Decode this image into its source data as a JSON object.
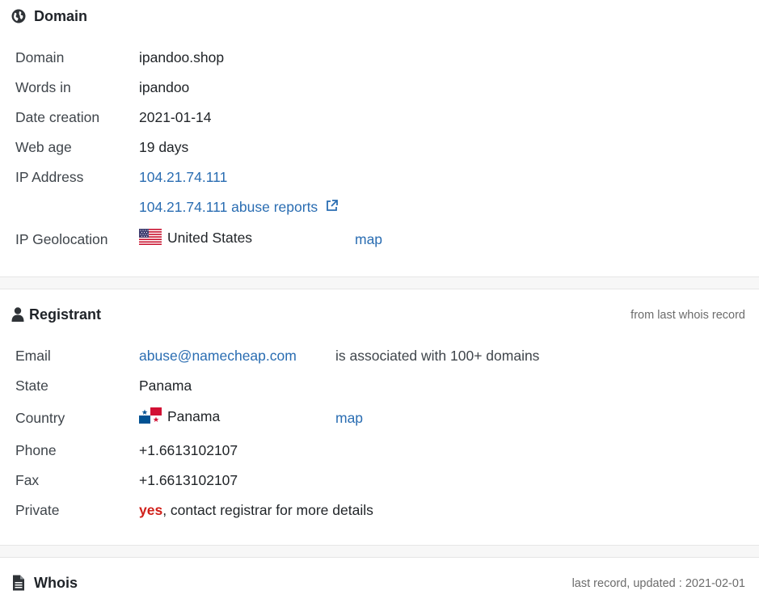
{
  "domain_section": {
    "title": "Domain",
    "rows": {
      "domain": {
        "label": "Domain",
        "value": "ipandoo.shop"
      },
      "words": {
        "label": "Words in",
        "value": "ipandoo"
      },
      "date_creation": {
        "label": "Date creation",
        "value": "2021-01-14"
      },
      "web_age": {
        "label": "Web age",
        "value": "19 days"
      },
      "ip": {
        "label": "IP Address",
        "value": "104.21.74.111",
        "abuse_link": "104.21.74.111 abuse reports"
      },
      "geo": {
        "label": "IP Geolocation",
        "country": "United States",
        "map_link": "map"
      }
    }
  },
  "registrant": {
    "title": "Registrant",
    "note": "from last whois record",
    "rows": {
      "email": {
        "label": "Email",
        "value": "abuse@namecheap.com",
        "note": "is associated with 100+ domains"
      },
      "state": {
        "label": "State",
        "value": "Panama"
      },
      "country": {
        "label": "Country",
        "value": "Panama",
        "map_link": "map"
      },
      "phone": {
        "label": "Phone",
        "value": "+1.6613102107"
      },
      "fax": {
        "label": "Fax",
        "value": "+1.6613102107"
      },
      "private": {
        "label": "Private",
        "highlight": "yes",
        "rest": ", contact registrar for more details"
      }
    }
  },
  "whois": {
    "title": "Whois",
    "note": "last record, updated : 2021-02-01"
  },
  "icons": {
    "domain": "globe-icon",
    "registrant": "user-icon",
    "whois": "document-icon",
    "external": "external-link-icon"
  },
  "colors": {
    "link": "#2a6db2",
    "highlight": "#d0201a"
  }
}
